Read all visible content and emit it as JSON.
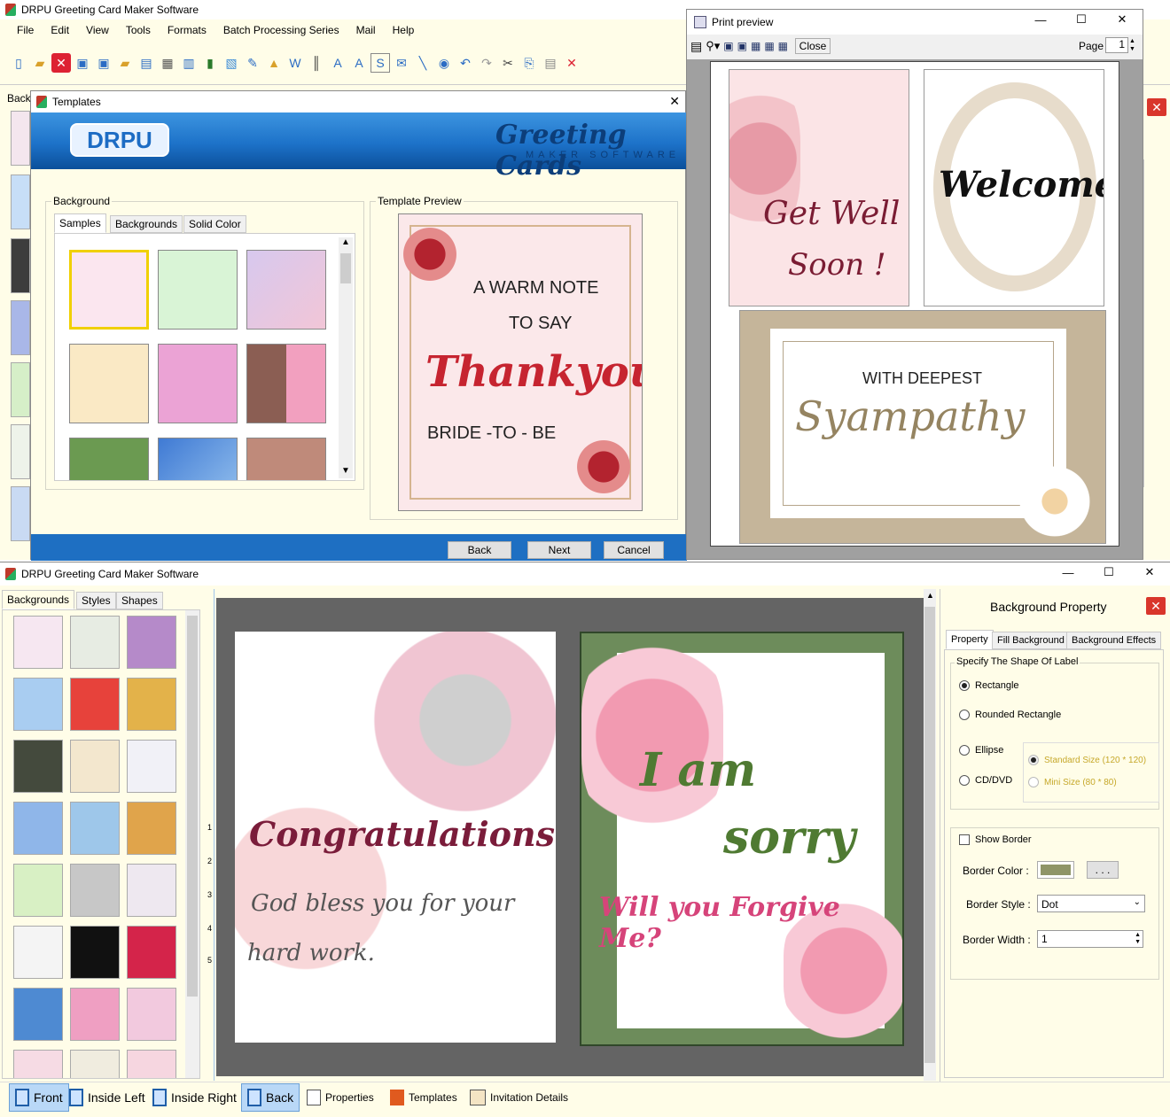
{
  "top_app": {
    "title": "DRPU Greeting Card Maker Software",
    "menu": [
      "File",
      "Edit",
      "View",
      "Tools",
      "Formats",
      "Batch Processing Series",
      "Mail",
      "Help"
    ],
    "side_label": "Back"
  },
  "templates_dialog": {
    "title": "Templates",
    "logo": "DRPU",
    "brand_line1": "Greeting Cards",
    "brand_line2": "MAKER SOFTWARE",
    "background_label": "Background",
    "tabs": [
      "Samples",
      "Backgrounds",
      "Solid Color"
    ],
    "preview_label": "Template Preview",
    "preview_text": {
      "l1": "A WARM NOTE",
      "l2": "TO SAY",
      "l3": "Thankyou",
      "l4": "BRIDE -TO - BE"
    },
    "buttons": {
      "back": "Back",
      "next": "Next",
      "cancel": "Cancel"
    }
  },
  "print_preview": {
    "title": "Print preview",
    "close": "Close",
    "page_label": "Page",
    "page_value": "1",
    "card1": {
      "l1": "Get Well",
      "l2": "Soon !"
    },
    "card2": "Welcome",
    "card3": {
      "l1": "WITH DEEPEST",
      "l2": "Syampathy"
    }
  },
  "main_app": {
    "title": "DRPU Greeting Card Maker Software",
    "left_tabs": [
      "Backgrounds",
      "Styles",
      "Shapes"
    ],
    "card_left": {
      "l1": "Congratulations!",
      "l2": "God bless you for your",
      "l3": "hard work."
    },
    "card_right": {
      "l1": "I am",
      "l2": "sorry",
      "l3": "Will you Forgive Me?"
    },
    "ruler_labels": [
      "1",
      "2",
      "3",
      "4",
      "5"
    ],
    "bottom": [
      "Front",
      "Inside Left",
      "Inside Right",
      "Back",
      "Properties",
      "Templates",
      "Invitation Details"
    ]
  },
  "property_panel": {
    "title": "Background Property",
    "tabs": [
      "Property",
      "Fill Background",
      "Background Effects"
    ],
    "shape_group": "Specify The Shape Of Label",
    "shapes": [
      "Rectangle",
      "Rounded Rectangle",
      "Ellipse",
      "CD/DVD"
    ],
    "sizes": [
      "Standard Size (120 * 120)",
      "Mini Size (80 * 80)"
    ],
    "show_border": "Show Border",
    "border_color_label": "Border Color :",
    "dots": ". . .",
    "border_style_label": "Border Style :",
    "border_style_value": "Dot",
    "border_width_label": "Border Width :",
    "border_width_value": "1",
    "border_color": "#8f9567",
    "selected_shape": "Rectangle"
  }
}
